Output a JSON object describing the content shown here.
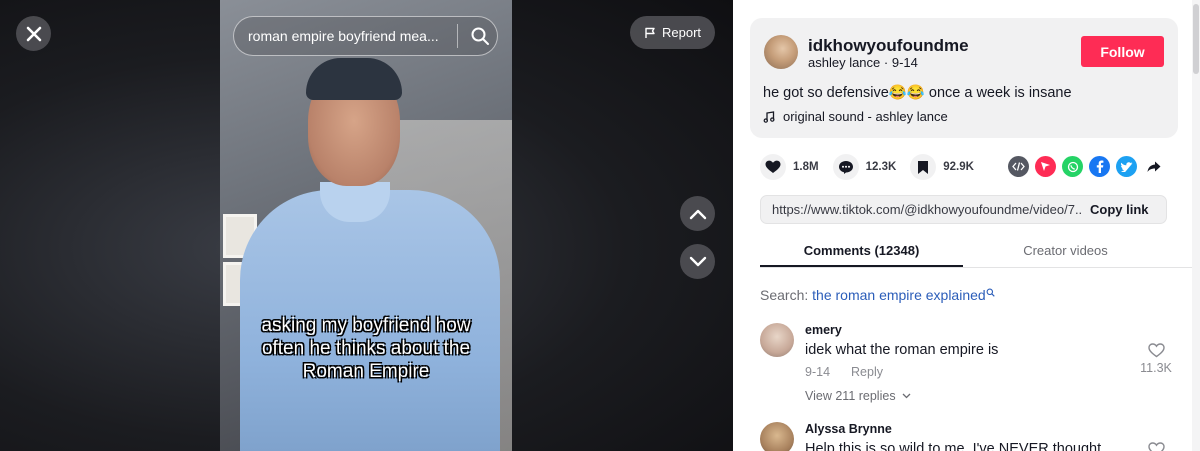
{
  "video": {
    "search_text": "roman empire boyfriend mea...",
    "report_label": "Report",
    "caption_lines": [
      "asking my boyfriend how",
      "often he thinks about the",
      "Roman Empire"
    ]
  },
  "author": {
    "username": "idkhowyoufoundme",
    "display_name": "ashley lance",
    "date": "9-14",
    "follow_label": "Follow",
    "description": "he got so defensive😂😂 once a week is insane",
    "sound": "original sound - ashley lance"
  },
  "stats": {
    "likes": "1.8M",
    "comments": "12.3K",
    "saves": "92.9K"
  },
  "share_icons": [
    "embed-icon",
    "send-icon",
    "whatsapp-icon",
    "facebook-icon",
    "twitter-icon",
    "share-arrow-icon"
  ],
  "link": {
    "url": "https://www.tiktok.com/@idkhowyoufoundme/video/7...",
    "copy_label": "Copy link"
  },
  "tabs": {
    "comments": "Comments (12348)",
    "creator": "Creator videos"
  },
  "comment_search": {
    "prefix": "Search:",
    "query": "the roman empire explained"
  },
  "comments": [
    {
      "name": "emery",
      "text": "idek what the roman empire is",
      "date": "9-14",
      "reply": "Reply",
      "likes": "11.3K",
      "view_replies": "View 211 replies"
    },
    {
      "name": "Alyssa Brynne",
      "text": "Help this is so wild to me. I've NEVER thought"
    }
  ],
  "colors": {
    "brand": "#fe2c55",
    "link_blue": "#2b5db9",
    "whatsapp": "#25d366",
    "facebook": "#1877f2",
    "twitter": "#1da1f2"
  }
}
